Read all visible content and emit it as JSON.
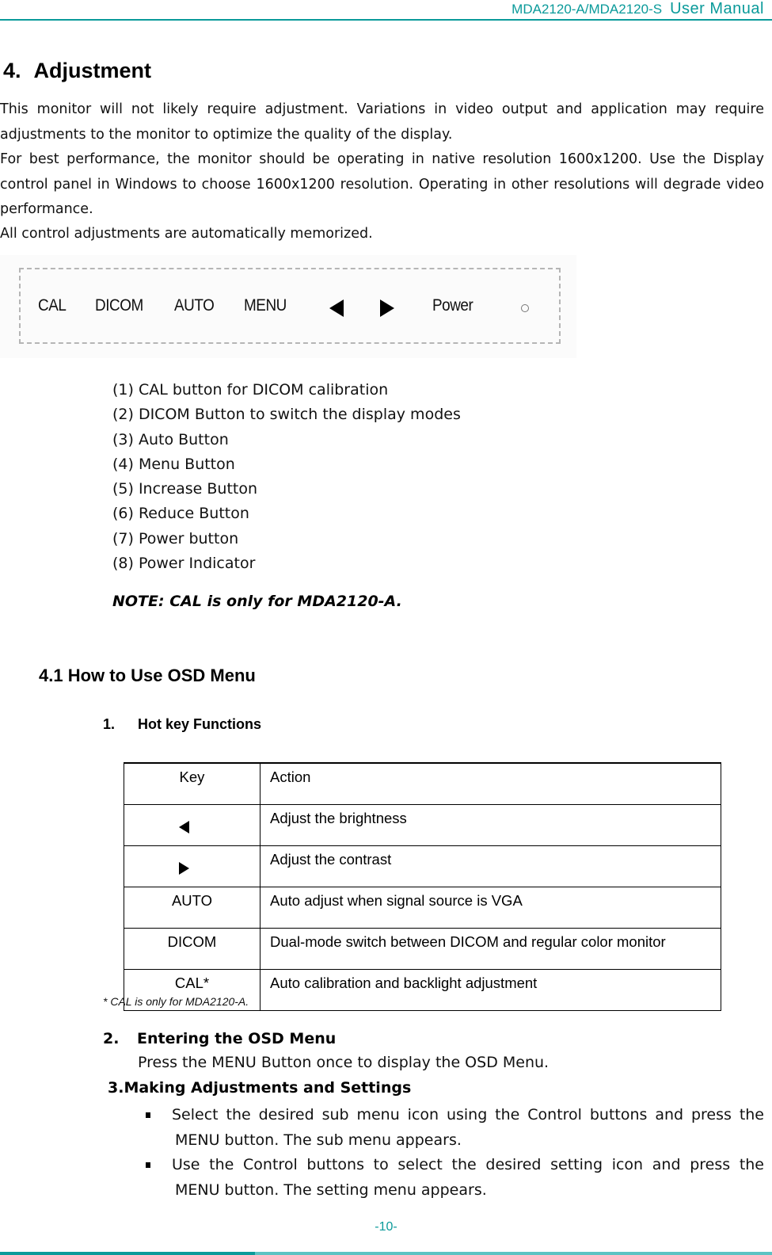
{
  "header": {
    "model": "MDA2120-A/MDA2120-S",
    "doc_type": "User Manual",
    "accent_color": "#0a9a9a"
  },
  "section": {
    "number": "4.",
    "title": "Adjustment"
  },
  "intro": {
    "p1": "This monitor will not likely require adjustment. Variations in video output and application may require adjustments to the monitor to optimize the quality of the display.",
    "p2": "For best performance, the monitor should be operating in native resolution 1600x1200. Use the Display control panel in Windows to choose 1600x1200 resolution. Operating in other resolutions will degrade video performance.",
    "p3": "All control adjustments are automatically memorized."
  },
  "control_panel": {
    "buttons": [
      {
        "label": "CAL",
        "icon": null
      },
      {
        "label": "DICOM",
        "icon": null
      },
      {
        "label": "AUTO",
        "icon": null
      },
      {
        "label": "MENU",
        "icon": null
      },
      {
        "label": "",
        "icon": "left-triangle-icon"
      },
      {
        "label": "",
        "icon": "right-triangle-icon"
      },
      {
        "label": "Power",
        "icon": null
      },
      {
        "label": "",
        "icon": "power-indicator-led-icon"
      }
    ]
  },
  "button_list": [
    "(1) CAL button for DICOM calibration",
    "(2) DICOM Button to switch the display modes",
    "(3) Auto Button",
    "(4) Menu Button",
    "(5) Increase Button",
    "(6) Reduce Button",
    "(7) Power button",
    "(8) Power Indicator"
  ],
  "note": "NOTE: CAL is only for MDA2120-A.",
  "subsection": {
    "title": "4.1 How to Use OSD Menu"
  },
  "hotkeys": {
    "number": "1.",
    "title": "Hot key Functions",
    "table": {
      "headers": [
        "Key",
        "Action"
      ],
      "rows": [
        {
          "key": "",
          "key_icon": "left-triangle-icon",
          "action": "Adjust the brightness"
        },
        {
          "key": "",
          "key_icon": "right-triangle-icon",
          "action": "Adjust the contrast"
        },
        {
          "key": "AUTO",
          "key_icon": null,
          "action": "Auto adjust when signal source is VGA"
        },
        {
          "key": "DICOM",
          "key_icon": null,
          "action": "Dual-mode switch between DICOM and regular color monitor"
        },
        {
          "key": "CAL*",
          "key_icon": null,
          "action": "Auto calibration and backlight adjustment"
        }
      ]
    },
    "footnote": "* CAL is only for MDA2120-A."
  },
  "entering": {
    "number": "2.",
    "title": "Entering the OSD Menu",
    "body": "Press the MENU Button once to display the OSD Menu."
  },
  "adjusting": {
    "title": "3.Making Adjustments and Settings",
    "bullets": [
      {
        "line1": "Select the desired sub menu icon using the Control buttons and press the",
        "line2": "MENU button. The sub menu appears."
      },
      {
        "line1": "Use the Control buttons to select the desired setting icon and press the",
        "line2": "MENU button. The setting menu appears."
      }
    ]
  },
  "footer": {
    "page_number": "-10-"
  }
}
